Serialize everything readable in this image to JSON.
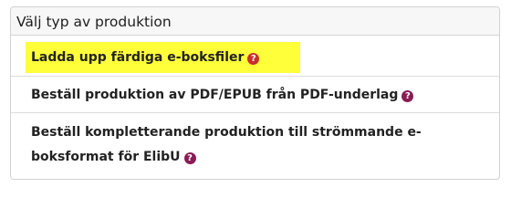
{
  "panel": {
    "title": "Välj typ av produktion"
  },
  "options": [
    {
      "label": "Ladda upp färdiga e-boksfiler",
      "help_icon": "?",
      "highlighted": true
    },
    {
      "label": "Beställ produktion av PDF/EPUB från PDF-underlag",
      "help_icon": "?",
      "highlighted": false
    },
    {
      "label": "Beställ kompletterande produktion till strömmande e-boksformat för ElibU",
      "help_icon": "?",
      "highlighted": false
    }
  ],
  "colors": {
    "highlight": "#ffff3a",
    "help_icon_first": "#c8302c",
    "help_icon": "#8a1c55"
  }
}
